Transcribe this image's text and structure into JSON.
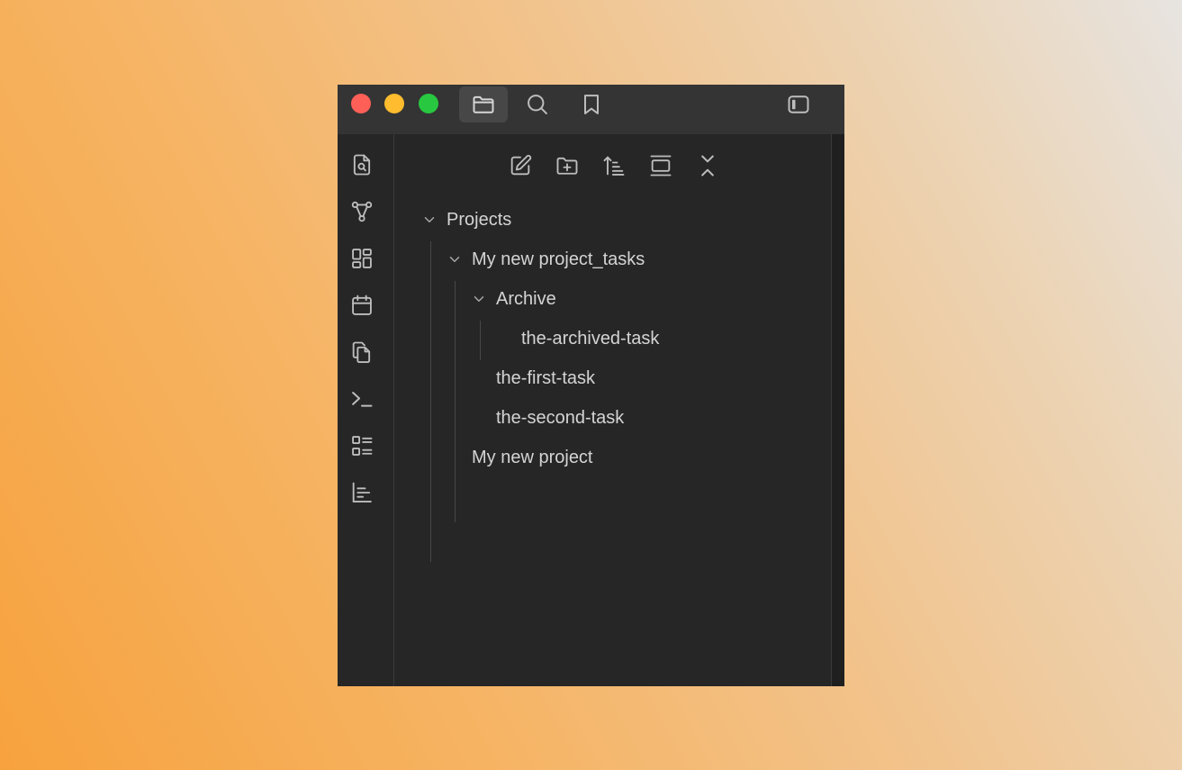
{
  "titlebar": {
    "tabs": [
      {
        "icon": "folder-icon",
        "active": true
      },
      {
        "icon": "search-icon",
        "active": false
      },
      {
        "icon": "bookmark-icon",
        "active": false
      }
    ],
    "right_icon": "sidebar-toggle-icon"
  },
  "ribbon": {
    "icons": [
      "file-search-icon",
      "graph-icon",
      "layout-grid-icon",
      "calendar-icon",
      "copy-icon",
      "terminal-icon",
      "checklist-icon",
      "chart-icon"
    ]
  },
  "file_explorer": {
    "actions": [
      "new-note-icon",
      "new-folder-icon",
      "sort-icon",
      "auto-reveal-icon",
      "collapse-all-icon"
    ],
    "tree": [
      {
        "label": "Projects",
        "expanded": true
      },
      {
        "label": "My new project_tasks",
        "expanded": true
      },
      {
        "label": "Archive",
        "expanded": true
      },
      {
        "label": "the-archived-task"
      },
      {
        "label": "the-first-task"
      },
      {
        "label": "the-second-task"
      },
      {
        "label": "My new project"
      }
    ]
  },
  "colors": {
    "window_bg": "#262626",
    "titlebar_bg": "#343434",
    "text": "#d4d4d4",
    "icon": "#bdbdbd",
    "close": "#fe5f57",
    "minimize": "#febc2e",
    "zoom": "#28c840"
  }
}
